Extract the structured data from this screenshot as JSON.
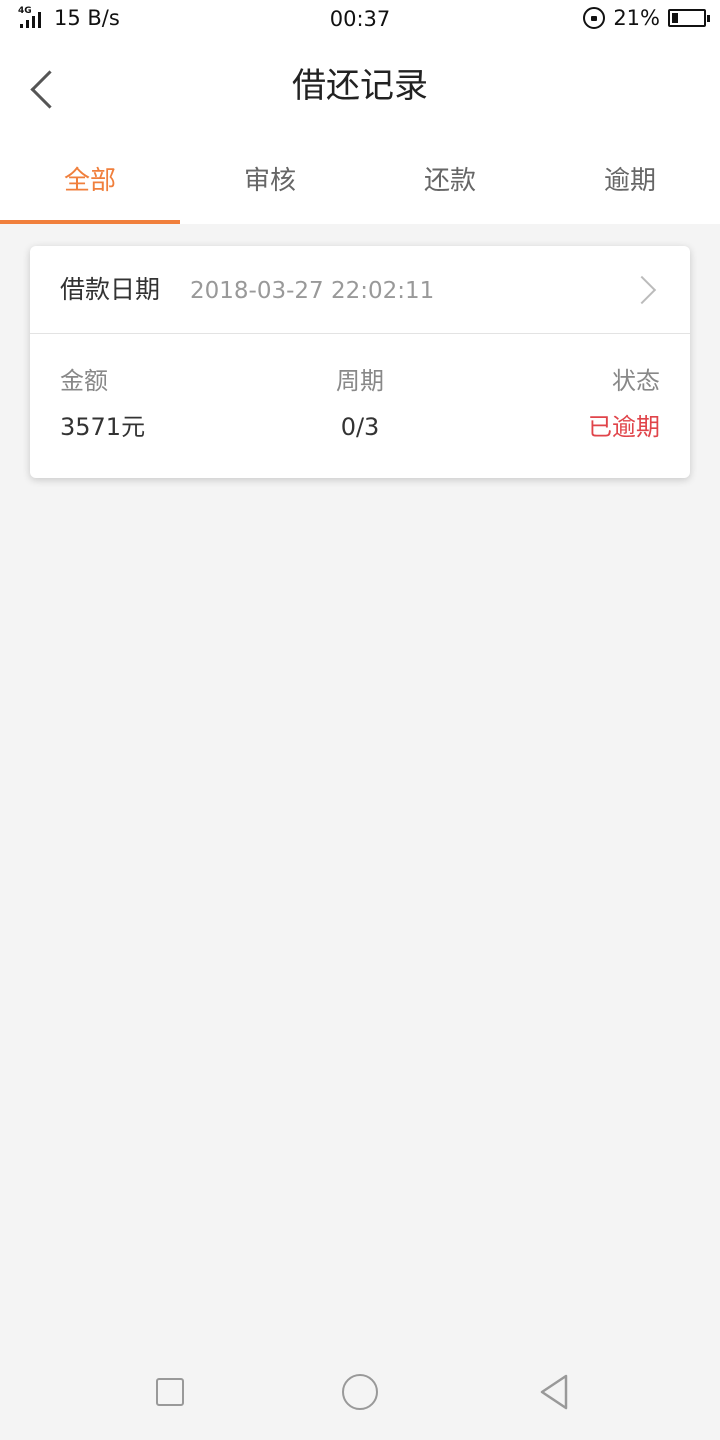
{
  "status_bar": {
    "network": "4G",
    "speed": "15 B/s",
    "time": "00:37",
    "battery_pct": "21%",
    "battery_level": 0.21
  },
  "header": {
    "title": "借还记录",
    "back_icon": "chevron-left-icon"
  },
  "tabs": [
    {
      "label": "全部",
      "active": true
    },
    {
      "label": "审核",
      "active": false
    },
    {
      "label": "还款",
      "active": false
    },
    {
      "label": "逾期",
      "active": false
    }
  ],
  "records": [
    {
      "date_label": "借款日期",
      "date_value": "2018-03-27 22:02:11",
      "amount_label": "金额",
      "amount_value": "3571元",
      "period_label": "周期",
      "period_value": "0/3",
      "status_label": "状态",
      "status_value": "已逾期"
    }
  ],
  "colors": {
    "accent": "#f07f3c",
    "overdue": "#e0444a",
    "background": "#f4f4f4"
  },
  "nav_bar": {
    "icons": [
      "recent-apps-icon",
      "home-icon",
      "back-icon"
    ]
  }
}
